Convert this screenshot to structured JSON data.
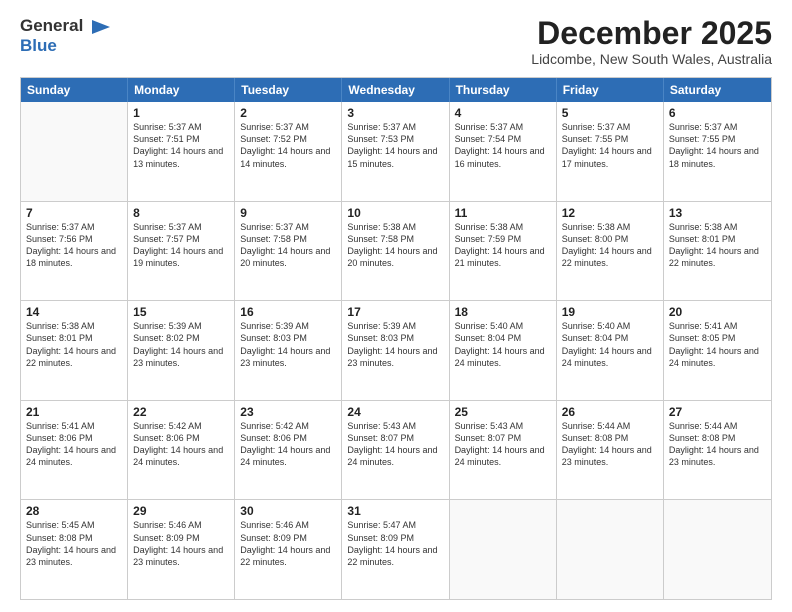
{
  "header": {
    "logo_line1": "General",
    "logo_line2": "Blue",
    "month_title": "December 2025",
    "location": "Lidcombe, New South Wales, Australia"
  },
  "calendar": {
    "days_of_week": [
      "Sunday",
      "Monday",
      "Tuesday",
      "Wednesday",
      "Thursday",
      "Friday",
      "Saturday"
    ],
    "rows": [
      [
        {
          "day": "",
          "empty": true
        },
        {
          "day": "1",
          "sunrise": "Sunrise: 5:37 AM",
          "sunset": "Sunset: 7:51 PM",
          "daylight": "Daylight: 14 hours and 13 minutes."
        },
        {
          "day": "2",
          "sunrise": "Sunrise: 5:37 AM",
          "sunset": "Sunset: 7:52 PM",
          "daylight": "Daylight: 14 hours and 14 minutes."
        },
        {
          "day": "3",
          "sunrise": "Sunrise: 5:37 AM",
          "sunset": "Sunset: 7:53 PM",
          "daylight": "Daylight: 14 hours and 15 minutes."
        },
        {
          "day": "4",
          "sunrise": "Sunrise: 5:37 AM",
          "sunset": "Sunset: 7:54 PM",
          "daylight": "Daylight: 14 hours and 16 minutes."
        },
        {
          "day": "5",
          "sunrise": "Sunrise: 5:37 AM",
          "sunset": "Sunset: 7:55 PM",
          "daylight": "Daylight: 14 hours and 17 minutes."
        },
        {
          "day": "6",
          "sunrise": "Sunrise: 5:37 AM",
          "sunset": "Sunset: 7:55 PM",
          "daylight": "Daylight: 14 hours and 18 minutes."
        }
      ],
      [
        {
          "day": "7",
          "sunrise": "Sunrise: 5:37 AM",
          "sunset": "Sunset: 7:56 PM",
          "daylight": "Daylight: 14 hours and 18 minutes."
        },
        {
          "day": "8",
          "sunrise": "Sunrise: 5:37 AM",
          "sunset": "Sunset: 7:57 PM",
          "daylight": "Daylight: 14 hours and 19 minutes."
        },
        {
          "day": "9",
          "sunrise": "Sunrise: 5:37 AM",
          "sunset": "Sunset: 7:58 PM",
          "daylight": "Daylight: 14 hours and 20 minutes."
        },
        {
          "day": "10",
          "sunrise": "Sunrise: 5:38 AM",
          "sunset": "Sunset: 7:58 PM",
          "daylight": "Daylight: 14 hours and 20 minutes."
        },
        {
          "day": "11",
          "sunrise": "Sunrise: 5:38 AM",
          "sunset": "Sunset: 7:59 PM",
          "daylight": "Daylight: 14 hours and 21 minutes."
        },
        {
          "day": "12",
          "sunrise": "Sunrise: 5:38 AM",
          "sunset": "Sunset: 8:00 PM",
          "daylight": "Daylight: 14 hours and 22 minutes."
        },
        {
          "day": "13",
          "sunrise": "Sunrise: 5:38 AM",
          "sunset": "Sunset: 8:01 PM",
          "daylight": "Daylight: 14 hours and 22 minutes."
        }
      ],
      [
        {
          "day": "14",
          "sunrise": "Sunrise: 5:38 AM",
          "sunset": "Sunset: 8:01 PM",
          "daylight": "Daylight: 14 hours and 22 minutes."
        },
        {
          "day": "15",
          "sunrise": "Sunrise: 5:39 AM",
          "sunset": "Sunset: 8:02 PM",
          "daylight": "Daylight: 14 hours and 23 minutes."
        },
        {
          "day": "16",
          "sunrise": "Sunrise: 5:39 AM",
          "sunset": "Sunset: 8:03 PM",
          "daylight": "Daylight: 14 hours and 23 minutes."
        },
        {
          "day": "17",
          "sunrise": "Sunrise: 5:39 AM",
          "sunset": "Sunset: 8:03 PM",
          "daylight": "Daylight: 14 hours and 23 minutes."
        },
        {
          "day": "18",
          "sunrise": "Sunrise: 5:40 AM",
          "sunset": "Sunset: 8:04 PM",
          "daylight": "Daylight: 14 hours and 24 minutes."
        },
        {
          "day": "19",
          "sunrise": "Sunrise: 5:40 AM",
          "sunset": "Sunset: 8:04 PM",
          "daylight": "Daylight: 14 hours and 24 minutes."
        },
        {
          "day": "20",
          "sunrise": "Sunrise: 5:41 AM",
          "sunset": "Sunset: 8:05 PM",
          "daylight": "Daylight: 14 hours and 24 minutes."
        }
      ],
      [
        {
          "day": "21",
          "sunrise": "Sunrise: 5:41 AM",
          "sunset": "Sunset: 8:06 PM",
          "daylight": "Daylight: 14 hours and 24 minutes."
        },
        {
          "day": "22",
          "sunrise": "Sunrise: 5:42 AM",
          "sunset": "Sunset: 8:06 PM",
          "daylight": "Daylight: 14 hours and 24 minutes."
        },
        {
          "day": "23",
          "sunrise": "Sunrise: 5:42 AM",
          "sunset": "Sunset: 8:06 PM",
          "daylight": "Daylight: 14 hours and 24 minutes."
        },
        {
          "day": "24",
          "sunrise": "Sunrise: 5:43 AM",
          "sunset": "Sunset: 8:07 PM",
          "daylight": "Daylight: 14 hours and 24 minutes."
        },
        {
          "day": "25",
          "sunrise": "Sunrise: 5:43 AM",
          "sunset": "Sunset: 8:07 PM",
          "daylight": "Daylight: 14 hours and 24 minutes."
        },
        {
          "day": "26",
          "sunrise": "Sunrise: 5:44 AM",
          "sunset": "Sunset: 8:08 PM",
          "daylight": "Daylight: 14 hours and 23 minutes."
        },
        {
          "day": "27",
          "sunrise": "Sunrise: 5:44 AM",
          "sunset": "Sunset: 8:08 PM",
          "daylight": "Daylight: 14 hours and 23 minutes."
        }
      ],
      [
        {
          "day": "28",
          "sunrise": "Sunrise: 5:45 AM",
          "sunset": "Sunset: 8:08 PM",
          "daylight": "Daylight: 14 hours and 23 minutes."
        },
        {
          "day": "29",
          "sunrise": "Sunrise: 5:46 AM",
          "sunset": "Sunset: 8:09 PM",
          "daylight": "Daylight: 14 hours and 23 minutes."
        },
        {
          "day": "30",
          "sunrise": "Sunrise: 5:46 AM",
          "sunset": "Sunset: 8:09 PM",
          "daylight": "Daylight: 14 hours and 22 minutes."
        },
        {
          "day": "31",
          "sunrise": "Sunrise: 5:47 AM",
          "sunset": "Sunset: 8:09 PM",
          "daylight": "Daylight: 14 hours and 22 minutes."
        },
        {
          "day": "",
          "empty": true
        },
        {
          "day": "",
          "empty": true
        },
        {
          "day": "",
          "empty": true
        }
      ]
    ]
  }
}
